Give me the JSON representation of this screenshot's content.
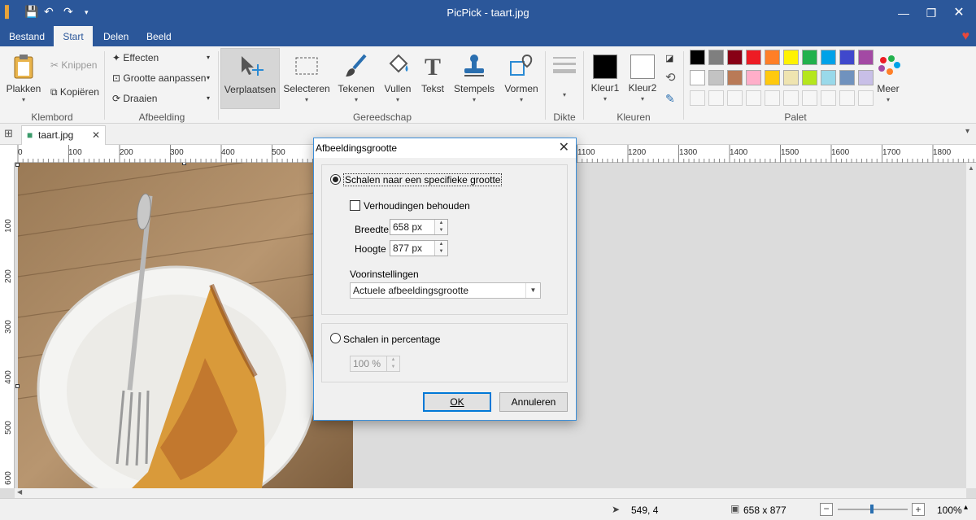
{
  "window": {
    "title": "PicPick - taart.jpg"
  },
  "tabs": [
    "Bestand",
    "Start",
    "Delen",
    "Beeld"
  ],
  "ribbon": {
    "klembord": {
      "label": "Klembord",
      "paste": "Plakken",
      "cut": "Knippen",
      "copy": "Kopiëren"
    },
    "afbeelding": {
      "label": "Afbeelding",
      "effects": "Effecten",
      "resize": "Grootte aanpassen",
      "rotate": "Draaien"
    },
    "gereedschap": {
      "label": "Gereedschap",
      "tools": [
        "Verplaatsen",
        "Selecteren",
        "Tekenen",
        "Vullen",
        "Tekst",
        "Stempels",
        "Vormen"
      ]
    },
    "dikte": {
      "label": "Dikte"
    },
    "kleuren": {
      "label": "Kleuren",
      "color1": "Kleur1",
      "color2": "Kleur2"
    },
    "palet": {
      "label": "Palet",
      "more": "Meer",
      "row1": [
        "#000000",
        "#7f7f7f",
        "#880015",
        "#ed1c24",
        "#ff7f27",
        "#fff200",
        "#22b14c",
        "#00a2e8",
        "#3f48cc",
        "#a349a4"
      ],
      "row2": [
        "#ffffff",
        "#c3c3c3",
        "#b97a57",
        "#ffaec9",
        "#ffc90e",
        "#efe4b0",
        "#b5e61d",
        "#99d9ea",
        "#7092be",
        "#c8bfe7"
      ]
    }
  },
  "doc_tab": {
    "name": "taart.jpg"
  },
  "ruler": {
    "h": [
      "0",
      "100",
      "200",
      "300",
      "400",
      "500",
      "1100",
      "1200",
      "1300",
      "1400",
      "1500",
      "1600",
      "1700",
      "1800"
    ],
    "v": [
      "100",
      "200",
      "300",
      "400",
      "500",
      "600"
    ]
  },
  "dialog": {
    "title": "Afbeeldingsgrootte",
    "scale_specific": "Schalen naar een specifieke grootte",
    "keep_ratio": "Verhoudingen behouden",
    "width_label": "Breedte",
    "width_value": "658 px",
    "height_label": "Hoogte",
    "height_value": "877 px",
    "presets_label": "Voorinstellingen",
    "presets_value": "Actuele afbeeldingsgrootte",
    "scale_percent": "Schalen in percentage",
    "percent_value": "100 %",
    "ok": "OK",
    "cancel": "Annuleren"
  },
  "status": {
    "cursor": "549, 4",
    "size": "658 x 877",
    "zoom": "100%"
  }
}
